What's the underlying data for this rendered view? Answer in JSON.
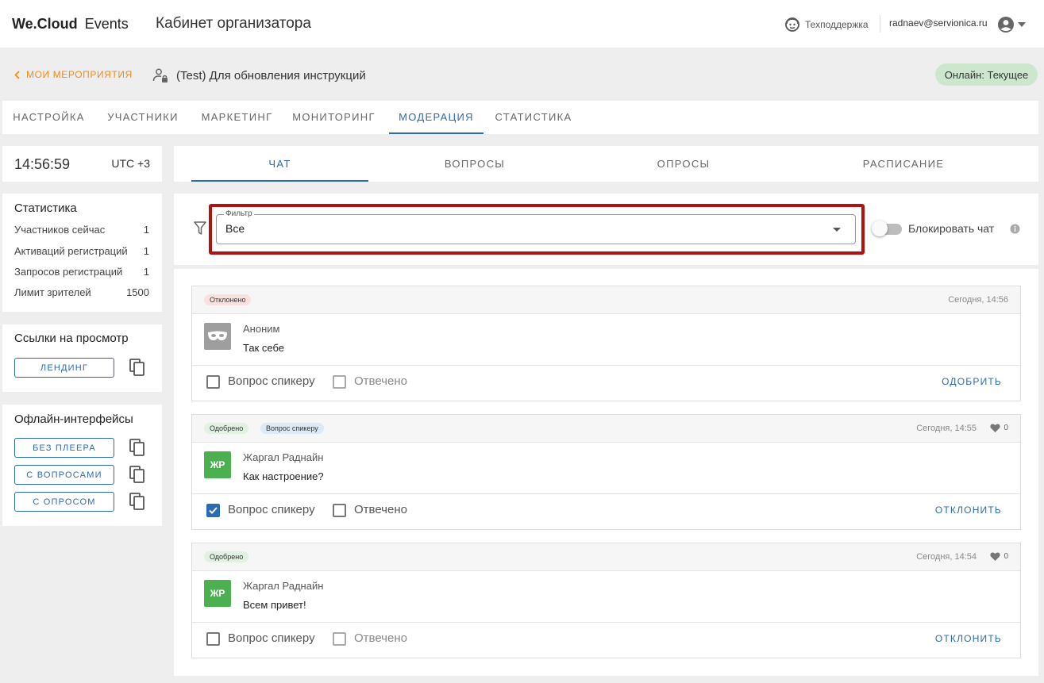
{
  "app": {
    "brand_bold": "We.Cloud",
    "brand_light": "Events",
    "section_title": "Кабинет организатора",
    "support_label": "Техподдержка",
    "user_email": "radnaev@servionica.ru"
  },
  "header": {
    "back_label": "МОИ МЕРОПРИЯТИЯ",
    "event_title": "(Test) Для обновления инструкций",
    "status_badge": "Онлайн: Текущее",
    "status_color": "#cde7cf"
  },
  "main_tabs": [
    {
      "label": "НАСТРОЙКА"
    },
    {
      "label": "УЧАСТНИКИ"
    },
    {
      "label": "МАРКЕТИНГ"
    },
    {
      "label": "МОНИТОРИНГ"
    },
    {
      "label": "МОДЕРАЦИЯ",
      "active": true
    },
    {
      "label": "СТАТИСТИКА"
    }
  ],
  "clock": {
    "time": "14:56:59",
    "timezone": "UTC +3"
  },
  "statistics": {
    "title": "Статистика",
    "rows": [
      {
        "label": "Участников сейчас",
        "value": "1"
      },
      {
        "label": "Активаций регистраций",
        "value": "1"
      },
      {
        "label": "Запросов регистраций",
        "value": "1"
      },
      {
        "label": "Лимит зрителей",
        "value": "1500"
      }
    ]
  },
  "view_links": {
    "title": "Ссылки на просмотр",
    "buttons": [
      {
        "label": "ЛЕНДИНГ"
      }
    ]
  },
  "offline": {
    "title": "Офлайн-интерфейсы",
    "buttons": [
      {
        "label": "БЕЗ ПЛЕЕРА"
      },
      {
        "label": "С ВОПРОСАМИ"
      },
      {
        "label": "С ОПРОСОМ"
      }
    ]
  },
  "sub_tabs": [
    {
      "label": "ЧАТ",
      "active": true
    },
    {
      "label": "ВОПРОСЫ"
    },
    {
      "label": "ОПРОСЫ"
    },
    {
      "label": "РАСПИСАНИЕ"
    }
  ],
  "filter": {
    "label": "Фильтр",
    "value": "Все",
    "block_chat_label": "Блокировать чат",
    "block_chat_on": false
  },
  "accent_color": "#2b6ab5",
  "highlight_color": "#b01212",
  "messages": [
    {
      "badges": [
        "Отклонено"
      ],
      "time": "Сегодня, 14:56",
      "likes": null,
      "avatar": "mask-icon",
      "initials": "",
      "author": "Аноним",
      "text": "Так себе",
      "question_label": "Вопрос спикеру",
      "question_checked": false,
      "answered_label": "Отвечено",
      "answered_checked": false,
      "action": "ОДОБРИТЬ"
    },
    {
      "badges": [
        "Одобрено",
        "Вопрос спикеру"
      ],
      "time": "Сегодня, 14:55",
      "likes": "0",
      "avatar": "initials",
      "initials": "ЖР",
      "author": "Жаргал Раднайн",
      "text": "Как настроение?",
      "question_label": "Вопрос спикеру",
      "question_checked": true,
      "answered_label": "Отвечено",
      "answered_checked": false,
      "action": "ОТКЛОНИТЬ"
    },
    {
      "badges": [
        "Одобрено"
      ],
      "time": "Сегодня, 14:54",
      "likes": "0",
      "avatar": "initials",
      "initials": "ЖР",
      "author": "Жаргал Раднайн",
      "text": "Всем привет!",
      "question_label": "Вопрос спикеру",
      "question_checked": false,
      "answered_label": "Отвечено",
      "answered_checked": false,
      "action": "ОТКЛОНИТЬ"
    }
  ]
}
